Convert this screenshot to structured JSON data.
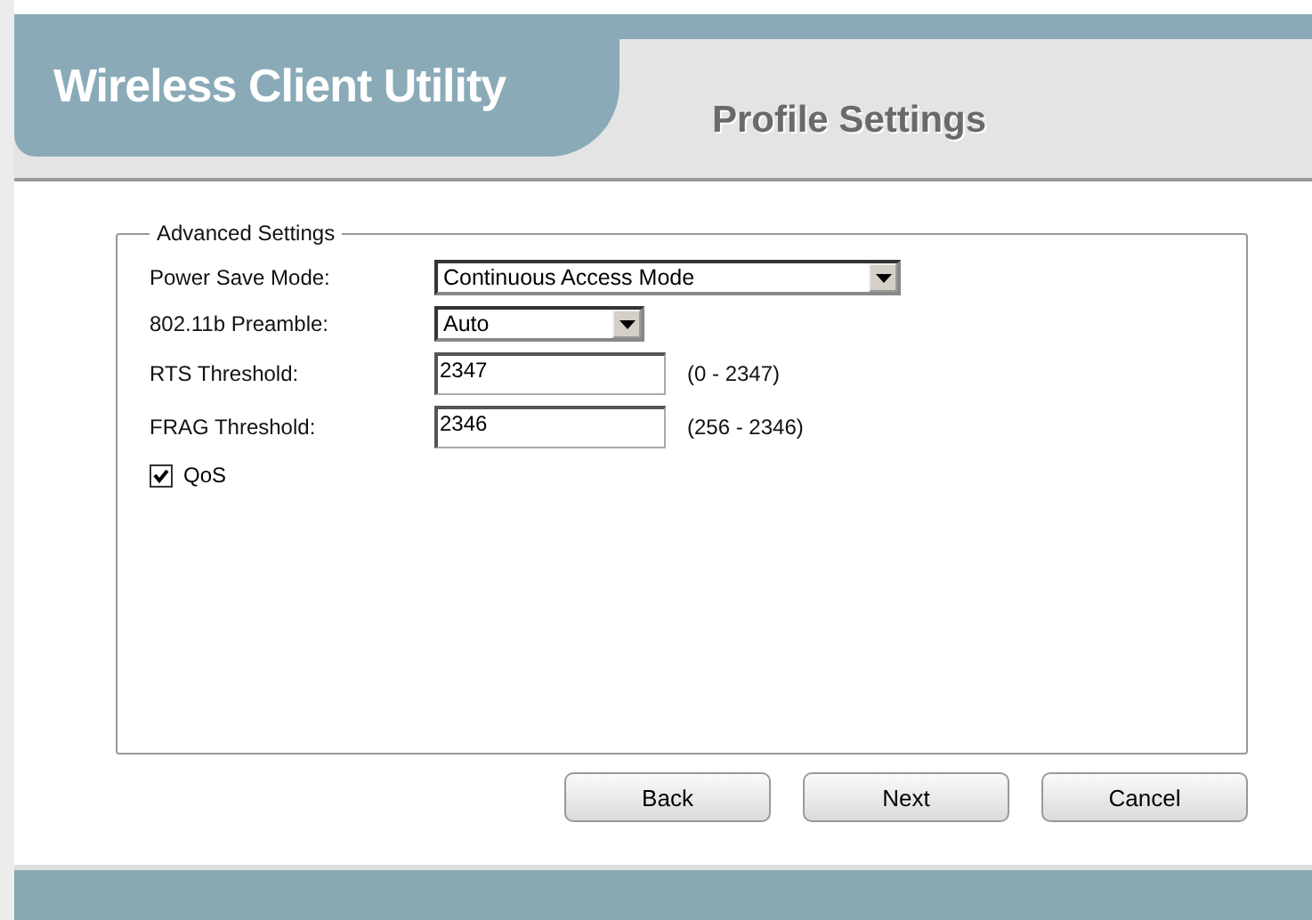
{
  "header": {
    "app_title": "Wireless Client Utility",
    "page_title": "Profile Settings"
  },
  "group": {
    "legend": "Advanced Settings",
    "fields": [
      {
        "kind": "select",
        "label": "Power Save Mode:",
        "value": "Continuous Access Mode",
        "wide": true
      },
      {
        "kind": "select",
        "label": "802.11b Preamble:",
        "value": "Auto",
        "wide": false
      },
      {
        "kind": "text",
        "label": "RTS Threshold:",
        "value": "2347",
        "range": "(0 - 2347)"
      },
      {
        "kind": "text",
        "label": "FRAG Threshold:",
        "value": "2346",
        "range": "(256 - 2346)"
      }
    ],
    "checkbox": {
      "label": "QoS",
      "checked": true
    }
  },
  "buttons": [
    "Back",
    "Next",
    "Cancel"
  ]
}
